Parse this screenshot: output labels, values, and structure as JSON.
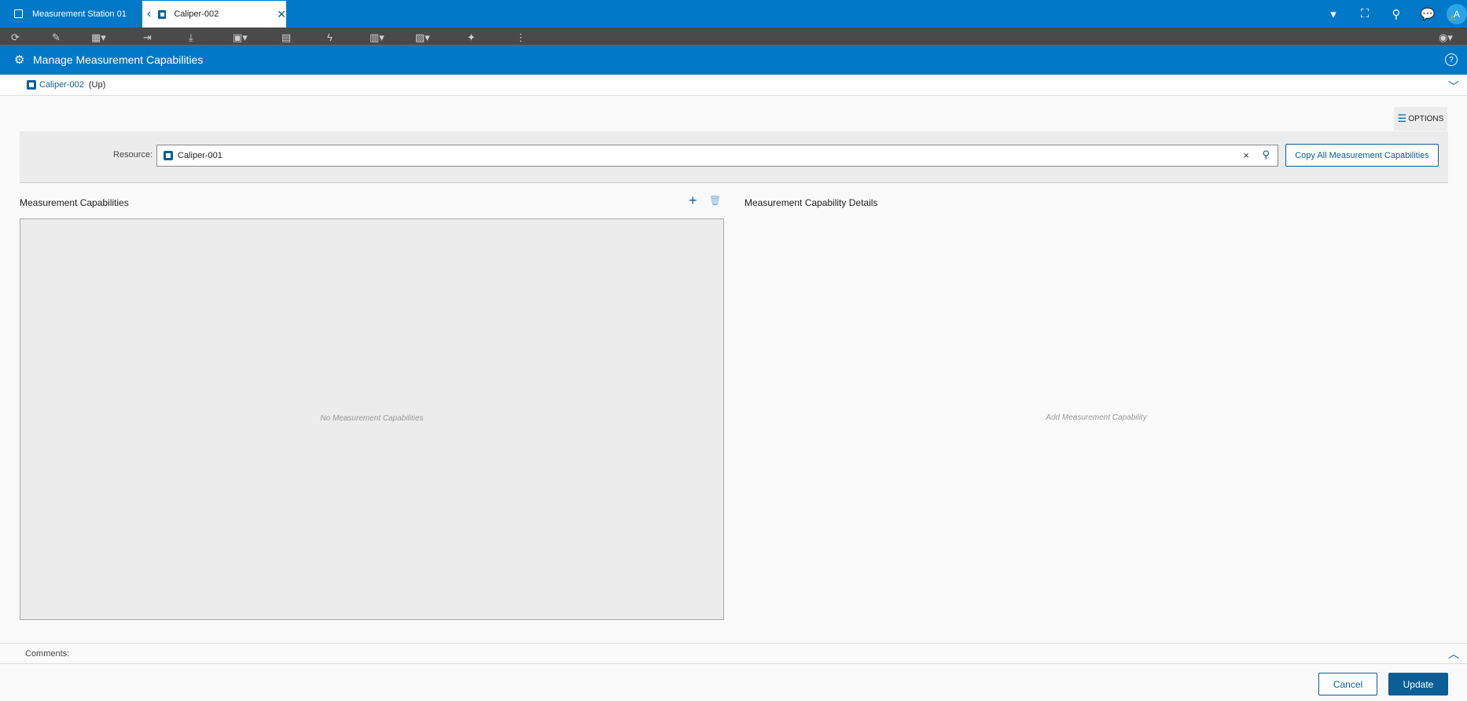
{
  "tabs": [
    {
      "label": "Measurement Station 01",
      "icon": "resource-icon"
    },
    {
      "label": "Caliper-002",
      "icon": "resource-icon",
      "active": true
    }
  ],
  "topbar_icons": [
    "dropdown-caret-icon",
    "fullscreen-icon",
    "search-icon",
    "chat-icon"
  ],
  "user": {
    "initial": "A"
  },
  "toolbar_icons": [
    "refresh-icon",
    "edit-icon",
    "layout-icon",
    "login-icon",
    "download-icon",
    "chart-icon",
    "book-icon",
    "lightning-icon",
    "document-icon",
    "bar-chart-icon",
    "magic-icon",
    "more-icon",
    "view-icon"
  ],
  "modal": {
    "title": "Manage Measurement Capabilities",
    "help": "?"
  },
  "context": {
    "resource": "Caliper-002",
    "state": "(Up)"
  },
  "options_label": "OPTIONS",
  "resource_field": {
    "label": "Resource:",
    "value": "Caliper-001",
    "clear": "×"
  },
  "copy_button": "Copy All Measurement Capabilities",
  "left_panel": {
    "title": "Measurement Capabilities",
    "add": "+",
    "empty": "No Measurement Capabilities"
  },
  "right_panel": {
    "title": "Measurement Capability Details",
    "empty": "Add Measurement Capability"
  },
  "comments_label": "Comments:",
  "footer": {
    "cancel": "Cancel",
    "update": "Update"
  },
  "colors": {
    "brand": "#0078c8",
    "accent": "#0b5e96"
  }
}
